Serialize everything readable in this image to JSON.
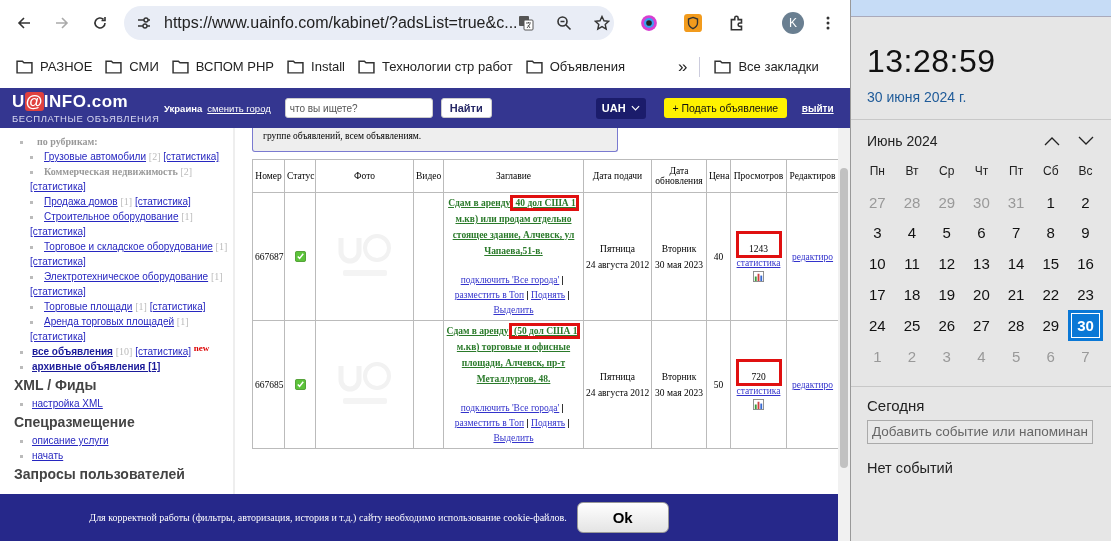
{
  "browser": {
    "forward_disabled": true,
    "url": "https://www.uainfo.com/kabinet/?adsList=true&c...",
    "profile_initial": "K",
    "bookmarks": [
      "РАЗНОЕ",
      "СМИ",
      "ВСПОМ PHP",
      "Install",
      "Технологии стр работ",
      "Объявления"
    ],
    "bookmarks_more": "»",
    "all_bookmarks": "Все закладки"
  },
  "site_header": {
    "logo": {
      "start": "U",
      "mark": "@",
      "end": "INFO.com"
    },
    "tagline": "БЕСПЛАТНЫЕ ОБЪЯВЛЕНИЯ",
    "region": "Украина",
    "change_region": "сменить город",
    "search": {
      "placeholder": "что вы ищете?"
    },
    "search_button": "Найти",
    "currency": "UAH",
    "post_button": "+ Подать объявление",
    "logout": "выйти"
  },
  "sidebar": {
    "rubrics_label": "по рубрикам:",
    "rubrics": [
      {
        "label": "Грузовые автомобили",
        "count": "[2]",
        "stats": "[статистика]",
        "disabled": false
      },
      {
        "label": "Коммерческая недвижимость",
        "count": "[2]",
        "stats": "[статистика]",
        "disabled": true
      },
      {
        "label": "Продажа домов",
        "count": "[1]",
        "stats": "[статистика]",
        "disabled": false
      },
      {
        "label": "Строительное оборудование",
        "count": "[1]",
        "stats": "[статистика]",
        "disabled": false
      },
      {
        "label": "Торговое и складское оборудование",
        "count": "[1]",
        "stats": "[статистика]",
        "disabled": false
      },
      {
        "label": "Электротехническое оборудование",
        "count": "[1]",
        "stats": "[статистика]",
        "disabled": false
      },
      {
        "label": "Торговые площади",
        "count": "[1]",
        "stats": "[статистика]",
        "disabled": false
      },
      {
        "label": "Аренда торговых площадей",
        "count": "[1]",
        "stats": "[статистика]",
        "disabled": false
      }
    ],
    "main_links": [
      {
        "label": "все объявления",
        "count": "[10]",
        "stats": "[статистика]",
        "badge": "new"
      },
      {
        "label": "архивные объявления [1]"
      }
    ],
    "sections": [
      {
        "title": "XML / Фиды",
        "links": [
          "настройка XML"
        ]
      },
      {
        "title": "Спецразмещение",
        "links": [
          "описание услуги",
          "начать"
        ]
      },
      {
        "title": "Запросы пользователей"
      }
    ]
  },
  "notice": "группе объявлений, всем объявлениям.",
  "table": {
    "columns": [
      "Номер",
      "Статус",
      "Фото",
      "Видео",
      "Заглавие",
      "Дата подачи",
      "Дата обновления",
      "Цена",
      "Просмотров",
      "Редактиров"
    ],
    "rows": [
      {
        "number": "667687",
        "status_checked": true,
        "title": [
          {
            "text": "Сдам в аренду",
            "highlighted": false
          },
          {
            "text": " 40 дол США 1",
            "highlighted": true
          },
          {
            "text": " м.кв) или продам отдельно стоящее здание, Алчевск, ул Чапаева,51-в.",
            "highlighted": false
          }
        ],
        "actions": [
          "подключить 'Все города'",
          "разместить в Топ",
          "Поднять",
          "Выделить"
        ],
        "submitted": [
          "Пятница",
          "24 августа 2012"
        ],
        "updated": [
          "Вторник",
          "30 мая 2023"
        ],
        "price": "40",
        "views": "1243",
        "views_highlighted": true,
        "stats_link": "статистика",
        "edit_link": "редактиро"
      },
      {
        "number": "667685",
        "status_checked": true,
        "title": [
          {
            "text": "Сдам в аренду",
            "highlighted": false
          },
          {
            "text": " (50 дол США 1",
            "highlighted": true
          },
          {
            "text": " м.кв) торговые и офисные площади, Алчевск, пр-т Металлургов, 48.",
            "highlighted": false
          }
        ],
        "actions": [
          "подключить 'Все города'",
          "разместить в Топ",
          "Поднять",
          "Выделить"
        ],
        "submitted": [
          "Пятница",
          "24 августа 2012"
        ],
        "updated": [
          "Вторник",
          "30 мая 2023"
        ],
        "price": "50",
        "views": "720",
        "views_highlighted": true,
        "stats_link": "статистика",
        "edit_link": "редактиро"
      }
    ]
  },
  "cookie_bar": {
    "text": "Для корректной работы (фильтры, авторизация, история и т.д.) сайту необходимо использование cookie-файлов.",
    "button": "Ok"
  },
  "calendar": {
    "time": "13:28:59",
    "date": "30 июня 2024 г.",
    "month": "Июнь 2024",
    "weekdays": [
      "Пн",
      "Вт",
      "Ср",
      "Чт",
      "Пт",
      "Сб",
      "Вс"
    ],
    "weeks": [
      [
        {
          "day": "27",
          "current_month": false,
          "selected": false
        },
        {
          "day": "28",
          "current_month": false,
          "selected": false
        },
        {
          "day": "29",
          "current_month": false,
          "selected": false
        },
        {
          "day": "30",
          "current_month": false,
          "selected": false
        },
        {
          "day": "31",
          "current_month": false,
          "selected": false
        },
        {
          "day": "1",
          "current_month": true,
          "selected": false
        },
        {
          "day": "2",
          "current_month": true,
          "selected": false
        }
      ],
      [
        {
          "day": "3",
          "current_month": true,
          "selected": false
        },
        {
          "day": "4",
          "current_month": true,
          "selected": false
        },
        {
          "day": "5",
          "current_month": true,
          "selected": false
        },
        {
          "day": "6",
          "current_month": true,
          "selected": false
        },
        {
          "day": "7",
          "current_month": true,
          "selected": false
        },
        {
          "day": "8",
          "current_month": true,
          "selected": false
        },
        {
          "day": "9",
          "current_month": true,
          "selected": false
        }
      ],
      [
        {
          "day": "10",
          "current_month": true,
          "selected": false
        },
        {
          "day": "11",
          "current_month": true,
          "selected": false
        },
        {
          "day": "12",
          "current_month": true,
          "selected": false
        },
        {
          "day": "13",
          "current_month": true,
          "selected": false
        },
        {
          "day": "14",
          "current_month": true,
          "selected": false
        },
        {
          "day": "15",
          "current_month": true,
          "selected": false
        },
        {
          "day": "16",
          "current_month": true,
          "selected": false
        }
      ],
      [
        {
          "day": "17",
          "current_month": true,
          "selected": false
        },
        {
          "day": "18",
          "current_month": true,
          "selected": false
        },
        {
          "day": "19",
          "current_month": true,
          "selected": false
        },
        {
          "day": "20",
          "current_month": true,
          "selected": false
        },
        {
          "day": "21",
          "current_month": true,
          "selected": false
        },
        {
          "day": "22",
          "current_month": true,
          "selected": false
        },
        {
          "day": "23",
          "current_month": true,
          "selected": false
        }
      ],
      [
        {
          "day": "24",
          "current_month": true,
          "selected": false
        },
        {
          "day": "25",
          "current_month": true,
          "selected": false
        },
        {
          "day": "26",
          "current_month": true,
          "selected": false
        },
        {
          "day": "27",
          "current_month": true,
          "selected": false
        },
        {
          "day": "28",
          "current_month": true,
          "selected": false
        },
        {
          "day": "29",
          "current_month": true,
          "selected": false
        },
        {
          "day": "30",
          "current_month": true,
          "selected": true
        }
      ],
      [
        {
          "day": "1",
          "current_month": false,
          "selected": false
        },
        {
          "day": "2",
          "current_month": false,
          "selected": false
        },
        {
          "day": "3",
          "current_month": false,
          "selected": false
        },
        {
          "day": "4",
          "current_month": false,
          "selected": false
        },
        {
          "day": "5",
          "current_month": false,
          "selected": false
        },
        {
          "day": "6",
          "current_month": false,
          "selected": false
        },
        {
          "day": "7",
          "current_month": false,
          "selected": false
        }
      ]
    ],
    "today_label": "Сегодня",
    "event_field": {
      "placeholder": "Добавить событие или напоминан"
    },
    "no_events": "Нет событий"
  }
}
